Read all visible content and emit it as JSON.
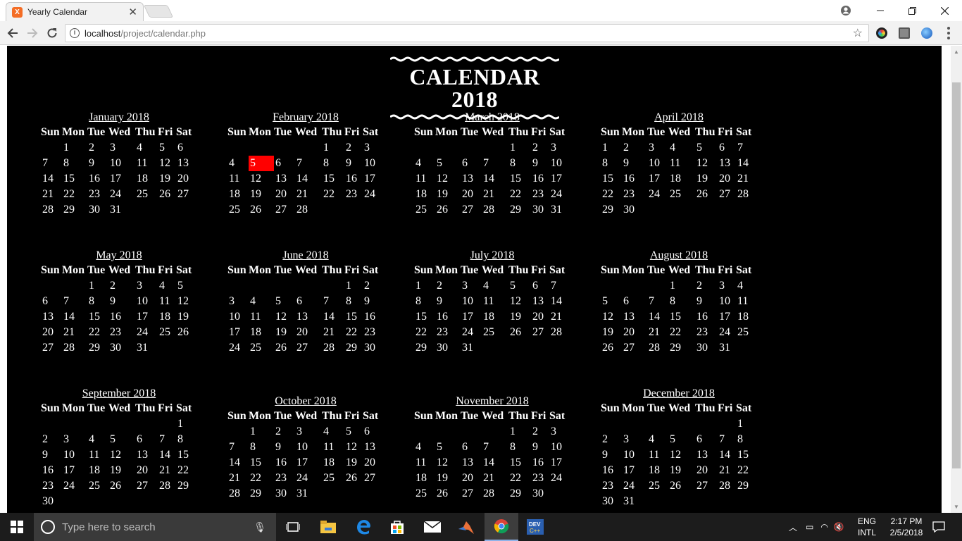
{
  "browser": {
    "tab_title": "Yearly Calendar",
    "tab_favicon": "X",
    "close_tab": "✕",
    "url_host": "localhost",
    "url_path": "/project/calendar.php"
  },
  "page": {
    "title": "CALENDAR 2018",
    "day_headers": [
      "Sun",
      "Mon",
      "Tue",
      "Wed",
      "Thu",
      "Fri",
      "Sat"
    ],
    "highlight": {
      "month": "February 2018",
      "day": "5",
      "color": "#ff0000"
    },
    "months": [
      {
        "name": "January 2018",
        "weeks": [
          [
            "",
            "1",
            "2",
            "3",
            "4",
            "5",
            "6"
          ],
          [
            "7",
            "8",
            "9",
            "10",
            "11",
            "12",
            "13"
          ],
          [
            "14",
            "15",
            "16",
            "17",
            "18",
            "19",
            "20"
          ],
          [
            "21",
            "22",
            "23",
            "24",
            "25",
            "26",
            "27"
          ],
          [
            "28",
            "29",
            "30",
            "31",
            "",
            "",
            ""
          ]
        ]
      },
      {
        "name": "February 2018",
        "weeks": [
          [
            "",
            "",
            "",
            "",
            "1",
            "2",
            "3"
          ],
          [
            "4",
            "5",
            "6",
            "7",
            "8",
            "9",
            "10"
          ],
          [
            "11",
            "12",
            "13",
            "14",
            "15",
            "16",
            "17"
          ],
          [
            "18",
            "19",
            "20",
            "21",
            "22",
            "23",
            "24"
          ],
          [
            "25",
            "26",
            "27",
            "28",
            "",
            "",
            ""
          ]
        ]
      },
      {
        "name": "March 2018",
        "weeks": [
          [
            "",
            "",
            "",
            "",
            "1",
            "2",
            "3"
          ],
          [
            "4",
            "5",
            "6",
            "7",
            "8",
            "9",
            "10"
          ],
          [
            "11",
            "12",
            "13",
            "14",
            "15",
            "16",
            "17"
          ],
          [
            "18",
            "19",
            "20",
            "21",
            "22",
            "23",
            "24"
          ],
          [
            "25",
            "26",
            "27",
            "28",
            "29",
            "30",
            "31"
          ]
        ]
      },
      {
        "name": "April 2018",
        "weeks": [
          [
            "1",
            "2",
            "3",
            "4",
            "5",
            "6",
            "7"
          ],
          [
            "8",
            "9",
            "10",
            "11",
            "12",
            "13",
            "14"
          ],
          [
            "15",
            "16",
            "17",
            "18",
            "19",
            "20",
            "21"
          ],
          [
            "22",
            "23",
            "24",
            "25",
            "26",
            "27",
            "28"
          ],
          [
            "29",
            "30",
            "",
            "",
            "",
            "",
            ""
          ]
        ]
      },
      {
        "name": "May 2018",
        "weeks": [
          [
            "",
            "",
            "1",
            "2",
            "3",
            "4",
            "5"
          ],
          [
            "6",
            "7",
            "8",
            "9",
            "10",
            "11",
            "12"
          ],
          [
            "13",
            "14",
            "15",
            "16",
            "17",
            "18",
            "19"
          ],
          [
            "20",
            "21",
            "22",
            "23",
            "24",
            "25",
            "26"
          ],
          [
            "27",
            "28",
            "29",
            "30",
            "31",
            "",
            ""
          ]
        ]
      },
      {
        "name": "June 2018",
        "weeks": [
          [
            "",
            "",
            "",
            "",
            "",
            "1",
            "2"
          ],
          [
            "3",
            "4",
            "5",
            "6",
            "7",
            "8",
            "9"
          ],
          [
            "10",
            "11",
            "12",
            "13",
            "14",
            "15",
            "16"
          ],
          [
            "17",
            "18",
            "19",
            "20",
            "21",
            "22",
            "23"
          ],
          [
            "24",
            "25",
            "26",
            "27",
            "28",
            "29",
            "30"
          ]
        ]
      },
      {
        "name": "July 2018",
        "weeks": [
          [
            "1",
            "2",
            "3",
            "4",
            "5",
            "6",
            "7"
          ],
          [
            "8",
            "9",
            "10",
            "11",
            "12",
            "13",
            "14"
          ],
          [
            "15",
            "16",
            "17",
            "18",
            "19",
            "20",
            "21"
          ],
          [
            "22",
            "23",
            "24",
            "25",
            "26",
            "27",
            "28"
          ],
          [
            "29",
            "30",
            "31",
            "",
            "",
            "",
            ""
          ]
        ]
      },
      {
        "name": "August 2018",
        "weeks": [
          [
            "",
            "",
            "",
            "1",
            "2",
            "3",
            "4"
          ],
          [
            "5",
            "6",
            "7",
            "8",
            "9",
            "10",
            "11"
          ],
          [
            "12",
            "13",
            "14",
            "15",
            "16",
            "17",
            "18"
          ],
          [
            "19",
            "20",
            "21",
            "22",
            "23",
            "24",
            "25"
          ],
          [
            "26",
            "27",
            "28",
            "29",
            "30",
            "31",
            ""
          ]
        ]
      },
      {
        "name": "September 2018",
        "weeks": [
          [
            "",
            "",
            "",
            "",
            "",
            "",
            "1"
          ],
          [
            "2",
            "3",
            "4",
            "5",
            "6",
            "7",
            "8"
          ],
          [
            "9",
            "10",
            "11",
            "12",
            "13",
            "14",
            "15"
          ],
          [
            "16",
            "17",
            "18",
            "19",
            "20",
            "21",
            "22"
          ],
          [
            "23",
            "24",
            "25",
            "26",
            "27",
            "28",
            "29"
          ],
          [
            "30",
            "",
            "",
            "",
            "",
            "",
            ""
          ]
        ]
      },
      {
        "name": "October 2018",
        "weeks": [
          [
            "",
            "1",
            "2",
            "3",
            "4",
            "5",
            "6"
          ],
          [
            "7",
            "8",
            "9",
            "10",
            "11",
            "12",
            "13"
          ],
          [
            "14",
            "15",
            "16",
            "17",
            "18",
            "19",
            "20"
          ],
          [
            "21",
            "22",
            "23",
            "24",
            "25",
            "26",
            "27"
          ],
          [
            "28",
            "29",
            "30",
            "31",
            "",
            "",
            ""
          ]
        ]
      },
      {
        "name": "November 2018",
        "weeks": [
          [
            "",
            "",
            "",
            "",
            "1",
            "2",
            "3"
          ],
          [
            "4",
            "5",
            "6",
            "7",
            "8",
            "9",
            "10"
          ],
          [
            "11",
            "12",
            "13",
            "14",
            "15",
            "16",
            "17"
          ],
          [
            "18",
            "19",
            "20",
            "21",
            "22",
            "23",
            "24"
          ],
          [
            "25",
            "26",
            "27",
            "28",
            "29",
            "30",
            ""
          ]
        ]
      },
      {
        "name": "December 2018",
        "weeks": [
          [
            "",
            "",
            "",
            "",
            "",
            "",
            "1"
          ],
          [
            "2",
            "3",
            "4",
            "5",
            "6",
            "7",
            "8"
          ],
          [
            "9",
            "10",
            "11",
            "12",
            "13",
            "14",
            "15"
          ],
          [
            "16",
            "17",
            "18",
            "19",
            "20",
            "21",
            "22"
          ],
          [
            "23",
            "24",
            "25",
            "26",
            "27",
            "28",
            "29"
          ],
          [
            "30",
            "31",
            "",
            "",
            "",
            "",
            ""
          ]
        ]
      }
    ]
  },
  "taskbar": {
    "search_placeholder": "Type here to search",
    "lang_top": "ENG",
    "lang_bottom": "INTL",
    "time": "2:17 PM",
    "date": "2/5/2018"
  }
}
